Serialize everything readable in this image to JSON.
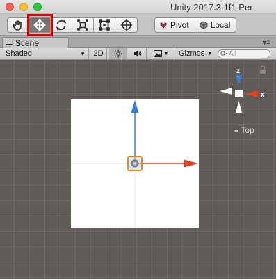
{
  "window": {
    "title": "Unity 2017.3.1f1 Per"
  },
  "toolbar": {
    "tools": [
      {
        "name": "hand-tool",
        "icon": "hand-icon",
        "active": false
      },
      {
        "name": "move-tool",
        "icon": "move-arrows-icon",
        "active": true
      },
      {
        "name": "rotate-tool",
        "icon": "rotate-icon",
        "active": false
      },
      {
        "name": "scale-tool",
        "icon": "scale-icon",
        "active": false
      },
      {
        "name": "rect-tool",
        "icon": "rect-icon",
        "active": false
      },
      {
        "name": "transform-tool",
        "icon": "transform-icon",
        "active": false
      }
    ],
    "pivot_label": "Pivot",
    "local_label": "Local"
  },
  "scene_tab": {
    "label": "Scene",
    "menu_glyph": "▾≡"
  },
  "scene_toolbar": {
    "shading_mode": "Shaded",
    "btn_2d": "2D",
    "gizmos_label": "Gizmos",
    "search_placeholder": "All"
  },
  "viewport": {
    "view_label": "Top",
    "axes": {
      "y_label": "z",
      "x_label": "x"
    },
    "colors": {
      "background": "#5f5c57",
      "grid": "#6e6b66",
      "x_axis": "#e8401c",
      "z_axis": "#3a7fd6",
      "selection": "#e88a1a"
    }
  }
}
